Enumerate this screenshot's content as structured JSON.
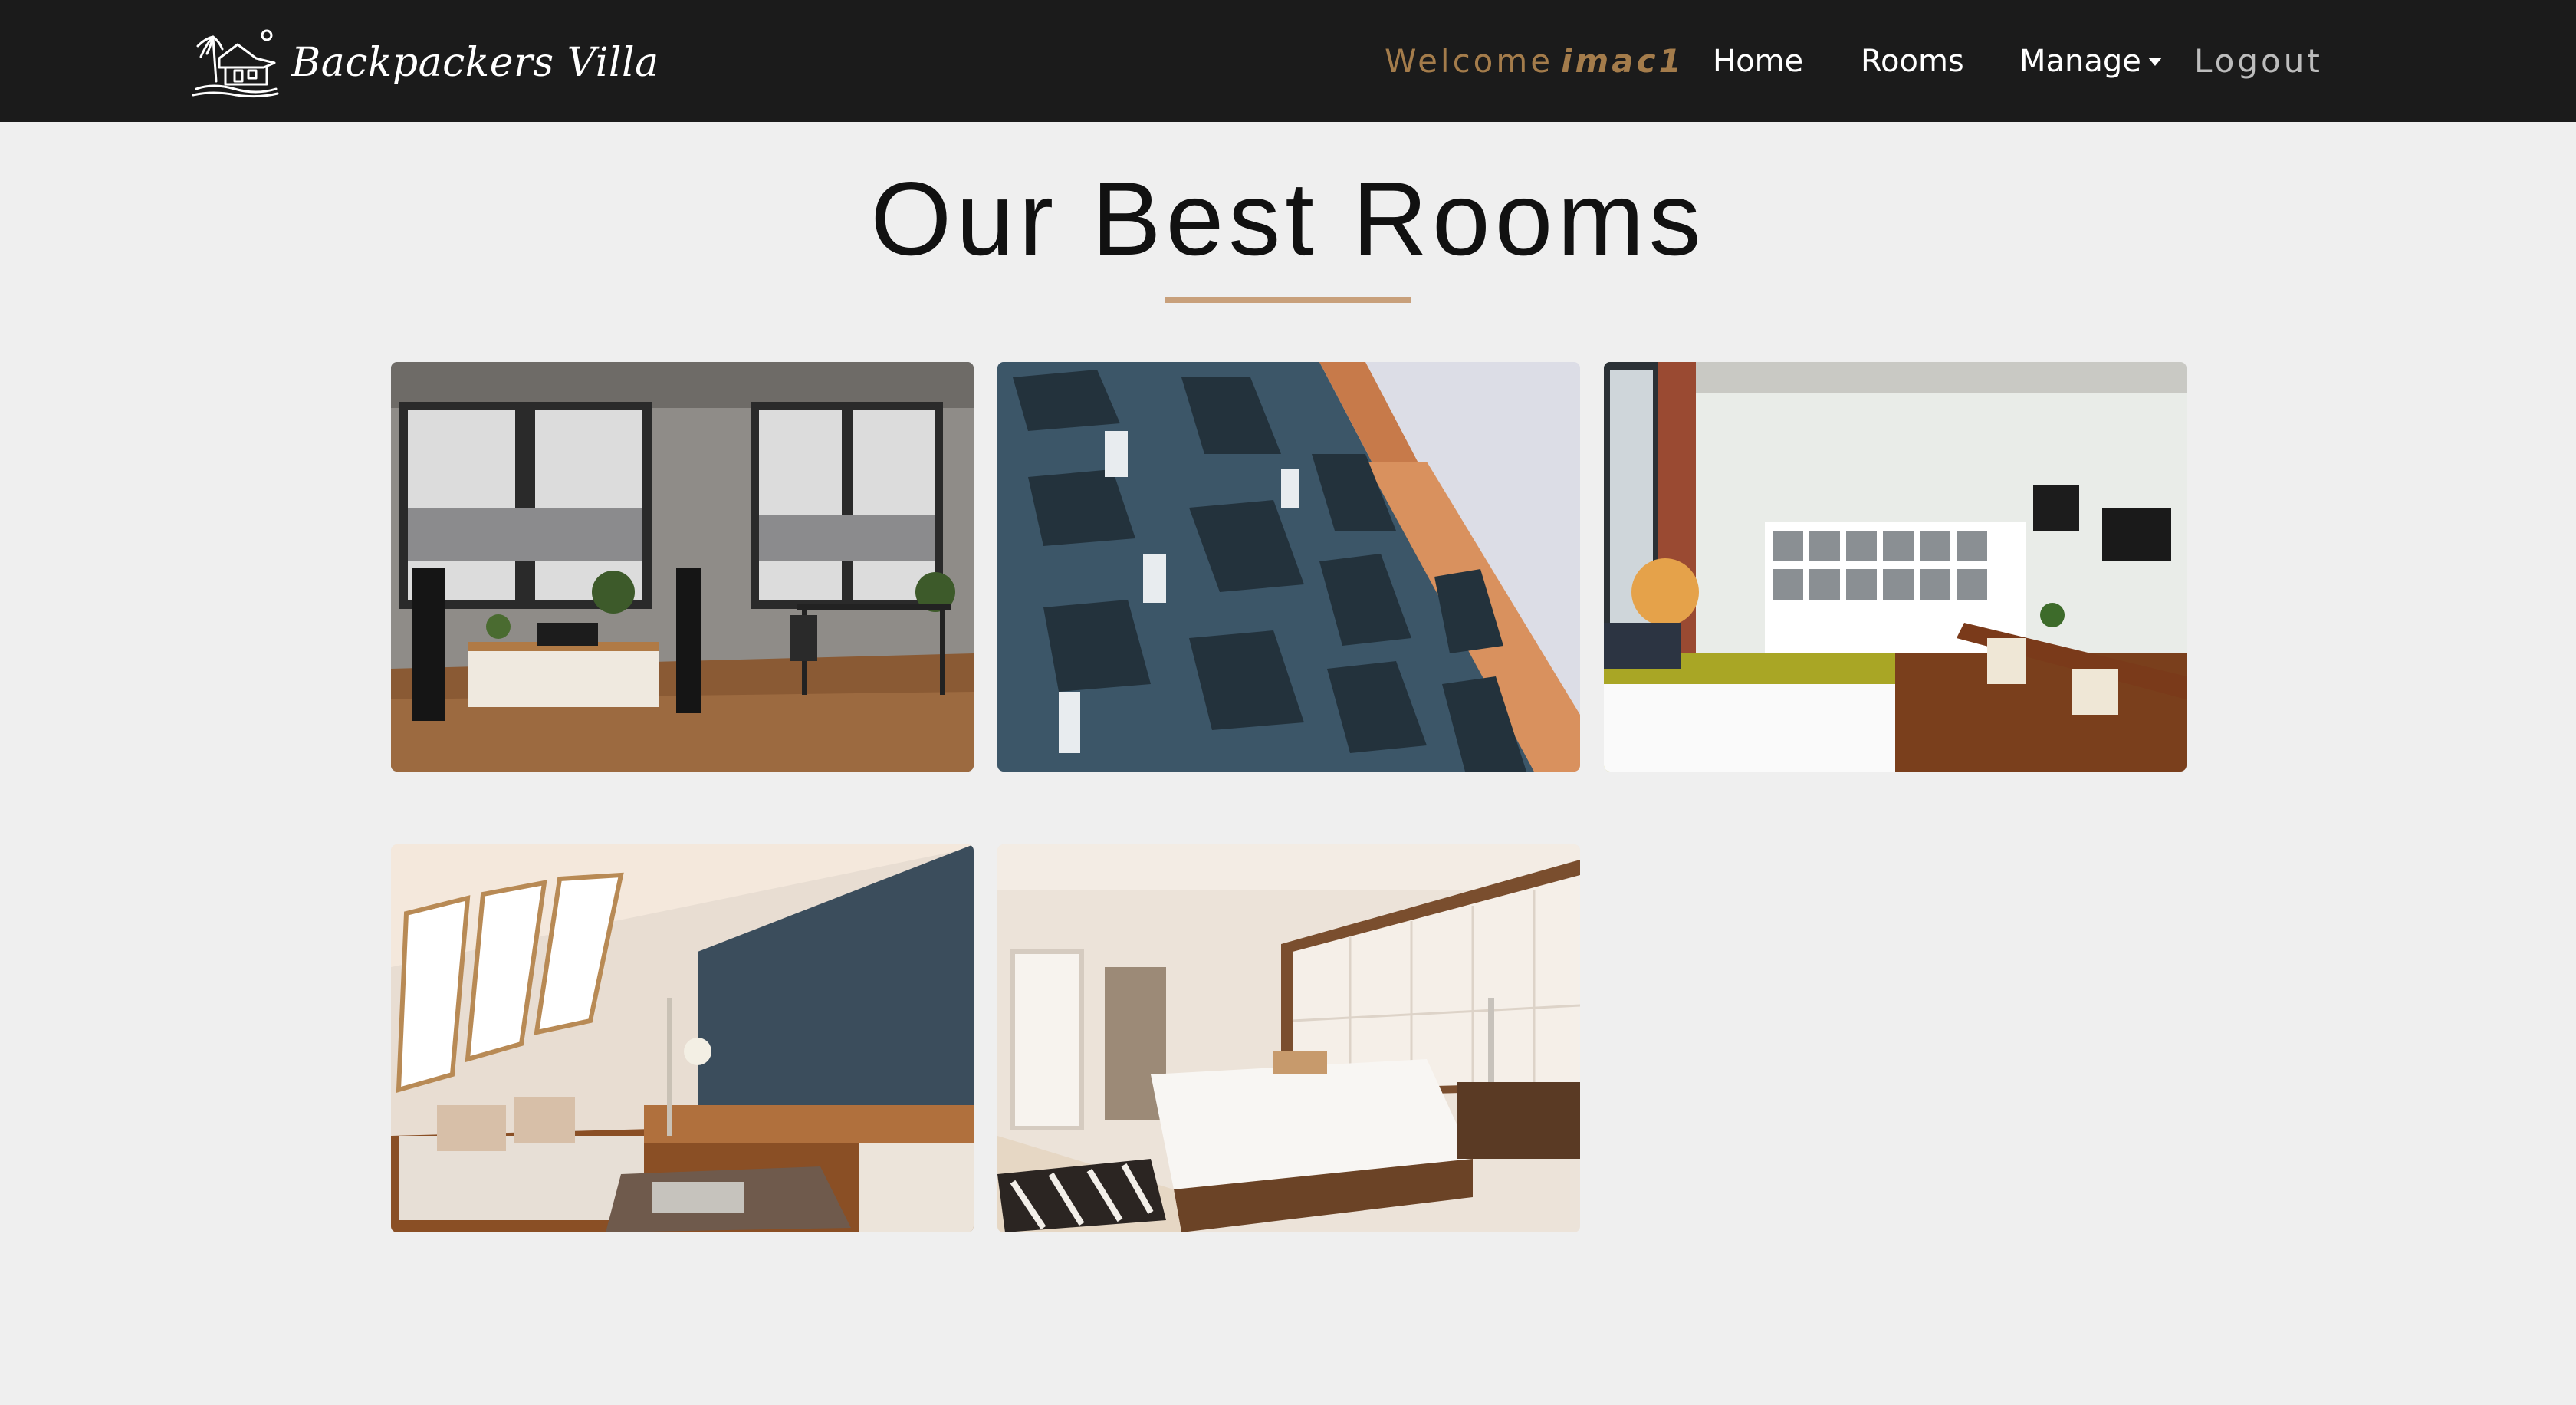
{
  "brand": {
    "name": "Backpackers Villa",
    "logo_icon": "villa-logo-icon"
  },
  "nav": {
    "welcome_prefix": "Welcome",
    "username": "imac1",
    "home": "Home",
    "rooms": "Rooms",
    "manage": "Manage",
    "manage_icon": "caret-down-icon",
    "logout": "Logout"
  },
  "main": {
    "title": "Our Best Rooms"
  },
  "colors": {
    "navbar_bg": "#1b1b1b",
    "page_bg": "#efefef",
    "accent": "#c8a07b",
    "welcome": "#a47c4b"
  },
  "rooms": [
    {
      "photo": "living-room-with-speakers"
    },
    {
      "photo": "apartment-building-balconies"
    },
    {
      "photo": "loft-with-bookshelf-and-dining-table"
    },
    {
      "photo": "attic-living-room"
    },
    {
      "photo": "hotel-bedroom"
    }
  ]
}
